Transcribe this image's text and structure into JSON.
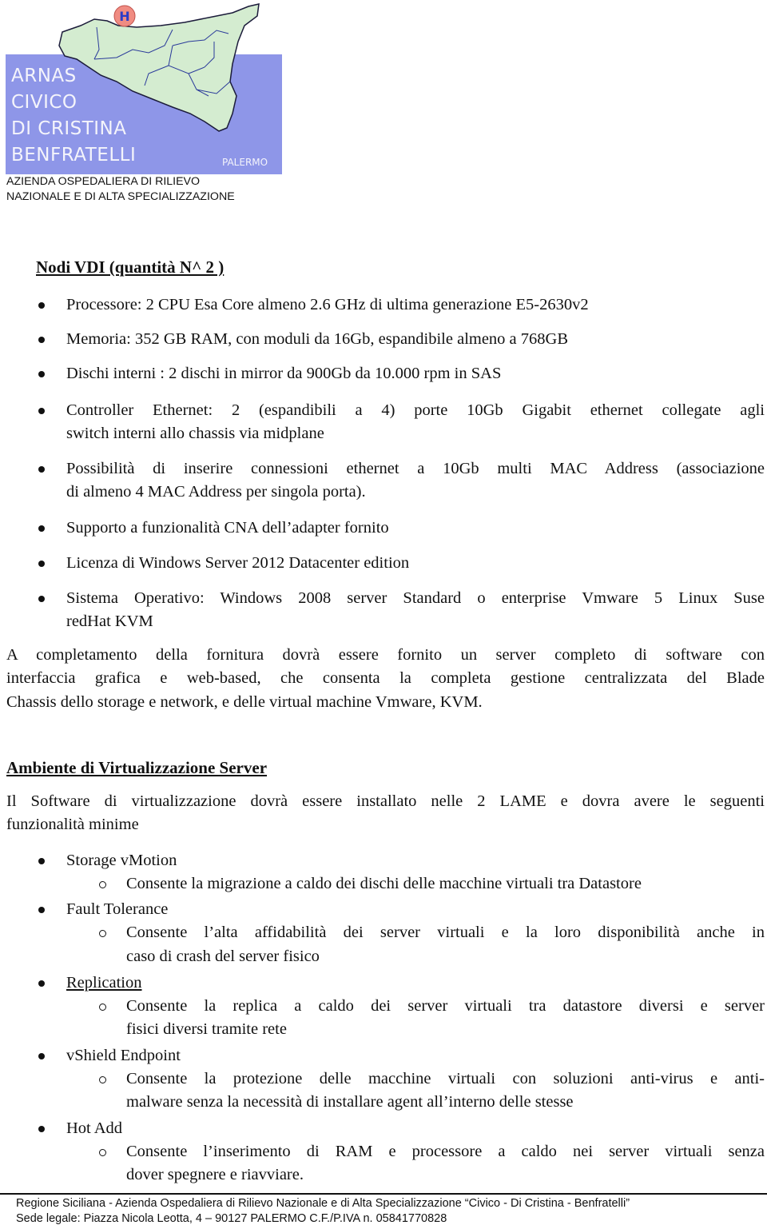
{
  "logo": {
    "lines": [
      "ARNAS",
      "CIVICO",
      "DI CRISTINA",
      "BENFRATELLI"
    ],
    "city": "PALERMO",
    "badge": "H",
    "subtitle_line1": "AZIENDA  OSPEDALIERA  DI  RILIEVO",
    "subtitle_line2": "NAZIONALE E DI ALTA SPECIALIZZAZIONE",
    "colors": {
      "box": "#8e96e8",
      "map": "#d4ecd0",
      "badge": "#f08c82",
      "badge_letter": "#2a3cc8"
    }
  },
  "section1": {
    "title": "Nodi VDI (quantità N^ 2 )",
    "items": [
      {
        "text": "Processore: 2 CPU Esa Core almeno 2.6 GHz di ultima generazione E5-2630v2"
      },
      {
        "text": "Memoria: 352 GB RAM, con moduli da 16Gb,  espandibile almeno a 768GB"
      },
      {
        "text": "Dischi interni : 2 dischi in mirror da 900Gb da 10.000 rpm in SAS"
      },
      {
        "text": "Controller Ethernet: 2 (espandibili a 4) porte 10Gb Gigabit ethernet collegate agli",
        "text2": "switch interni allo chassis via midplane"
      },
      {
        "text": "Possibilità di inserire connessioni ethernet a 10Gb multi MAC Address (associazione",
        "text2": "di almeno 4 MAC Address per singola porta)."
      },
      {
        "text": "Supporto a funzionalità CNA dell’adapter fornito"
      },
      {
        "text": "Licenza di Windows Server 2012 Datacenter edition"
      },
      {
        "text": "Sistema Operativo: Windows 2008 server Standard o enterprise Vmware 5 Linux Suse",
        "text2": "redHat KVM"
      }
    ],
    "paragraph": [
      "A completamento della fornitura dovrà essere fornito un server completo di software con",
      "interfaccia grafica e web-based, che consenta la completa gestione centralizzata del Blade",
      "Chassis dello storage e network, e delle virtual machine Vmware, KVM."
    ]
  },
  "section2": {
    "title": "Ambiente di Virtualizzazione Server",
    "intro": [
      "Il Software di virtualizzazione dovrà essere installato nelle 2 LAME e dovra avere le seguenti",
      "funzionalità minime"
    ],
    "features": [
      {
        "name": "Storage vMotion",
        "desc": [
          "Consente la migrazione a caldo dei dischi delle macchine virtuali tra Datastore"
        ]
      },
      {
        "name": "Fault Tolerance",
        "desc": [
          "Consente l’alta affidabilità dei server virtuali e la loro disponibilità anche in",
          "caso di crash del server fisico"
        ]
      },
      {
        "name": "Replication",
        "desc": [
          "Consente la replica a caldo dei server virtuali tra datastore diversi e server",
          "fisici diversi tramite rete"
        ]
      },
      {
        "name": "vShield Endpoint",
        "desc": [
          "Consente la protezione delle macchine virtuali con soluzioni anti-virus e anti-",
          "malware senza la necessità di installare agent all’interno delle stesse"
        ]
      },
      {
        "name": "Hot Add",
        "desc": [
          "Consente l’inserimento di RAM e processore a caldo nei server virtuali senza",
          "dover spegnere e riavviare."
        ]
      }
    ]
  },
  "footer": {
    "line1": "Regione Siciliana - Azienda Ospedaliera di Rilievo Nazionale e di Alta Specializzazione “Civico - Di Cristina - Benfratelli”",
    "line2": "Sede legale: Piazza Nicola Leotta, 4 – 90127 PALERMO C.F./P.IVA n. 05841770828"
  }
}
